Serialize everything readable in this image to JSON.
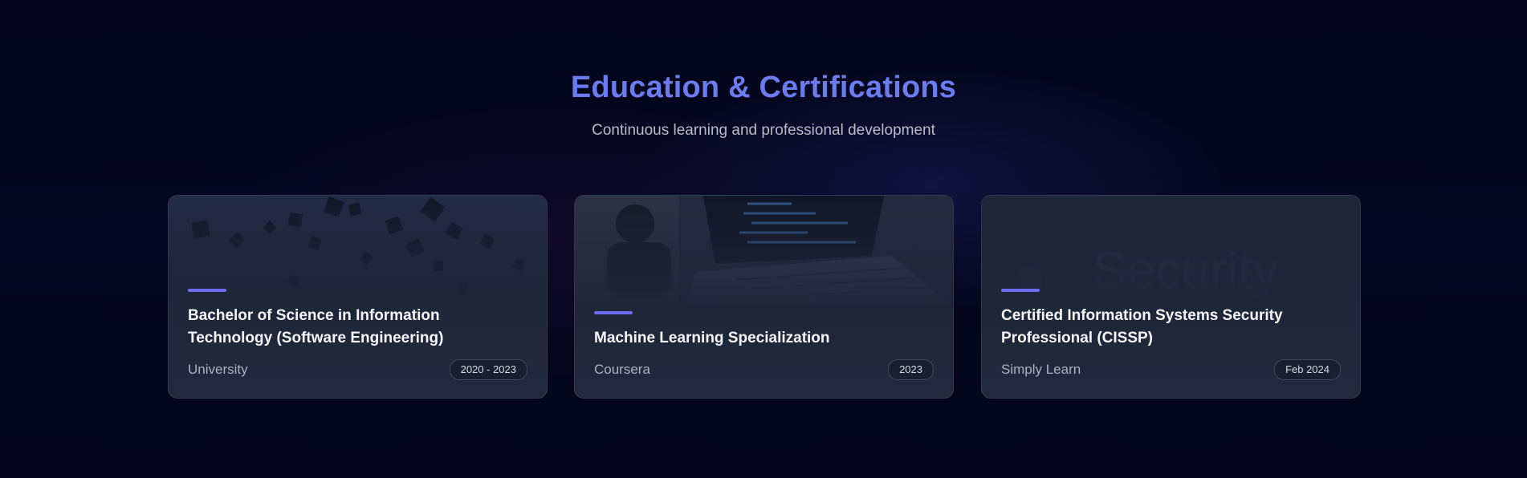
{
  "section": {
    "title": "Education & Certifications",
    "subtitle": "Continuous learning and professional development"
  },
  "colors": {
    "background": "#05061a",
    "title": "#6a7cf0",
    "accent_bar": "#6b6ef2",
    "card_bg": "#1f2638",
    "card_title": "#f4f6fb",
    "muted_text": "#aab1c0"
  },
  "cards": [
    {
      "title": "Bachelor of Science in Information Technology (Software Engineering)",
      "issuer": "University",
      "date": "2020 - 2023",
      "image": "graduation-caps-image"
    },
    {
      "title": "Machine Learning Specialization",
      "issuer": "Coursera",
      "date": "2023",
      "image": "laptop-coding-image"
    },
    {
      "title": "Certified Information Systems Security Professional (CISSP)",
      "issuer": "Simply Learn",
      "date": "Feb 2024",
      "image": "security-image",
      "image_text": "Security"
    }
  ]
}
